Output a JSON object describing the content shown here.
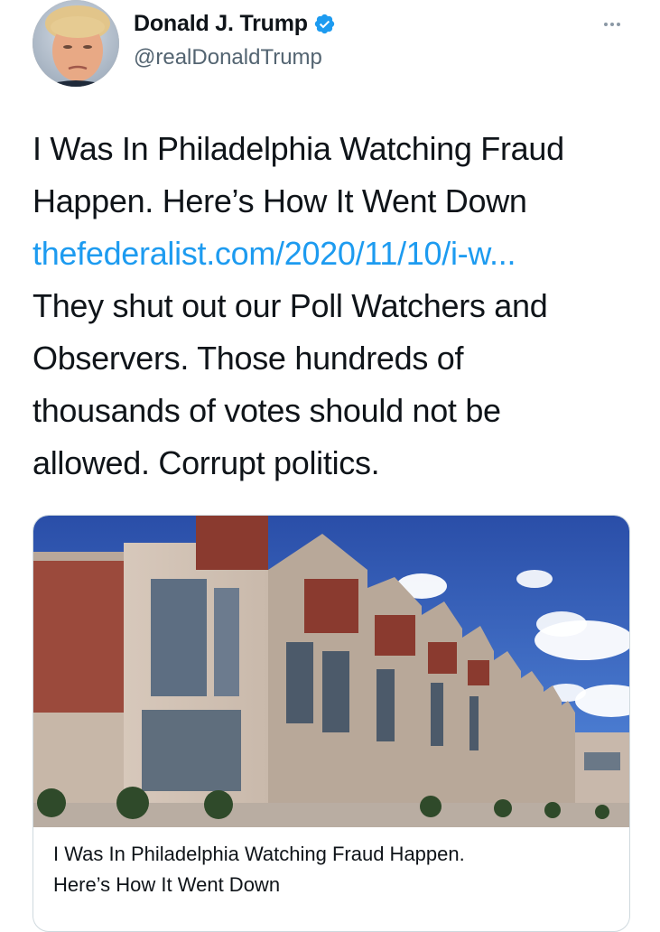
{
  "author": {
    "display_name": "Donald J. Trump",
    "handle": "@realDonaldTrump",
    "verified": true,
    "verified_color": "#1d9bf0"
  },
  "tweet": {
    "line_1": "I Was In Philadelphia Watching Fraud",
    "line_2": "Happen. Here’s How It Went Down",
    "link_text": "thefederalist.com/2020/11/10/i-w...",
    "line_4": "They shut out our Poll Watchers and",
    "line_5": "Observers. Those hundreds of",
    "line_6": "thousands of votes should not be",
    "line_7": "allowed. Corrupt politics."
  },
  "card": {
    "title_line_1": "I Was In Philadelphia Watching Fraud Happen.",
    "title_line_2": "Here’s How It Went Down"
  },
  "icons": {
    "more": "more-horizontal-icon",
    "verified": "verified-badge-icon"
  },
  "colors": {
    "link": "#1d9bf0",
    "text": "#0f1419",
    "secondary": "#536471",
    "border": "#cfd9de"
  }
}
